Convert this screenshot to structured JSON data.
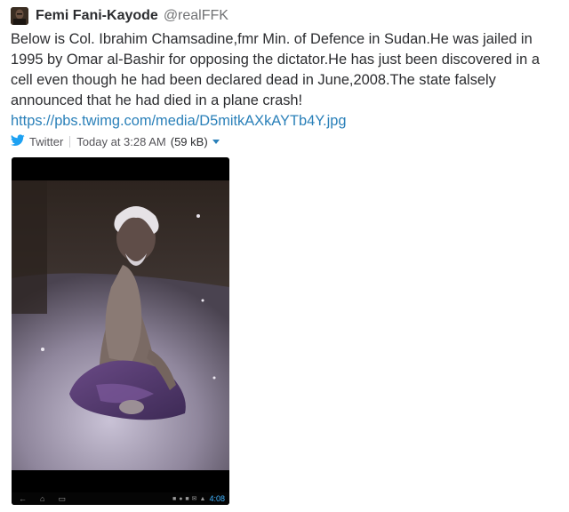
{
  "author": {
    "name": "Femi Fani-Kayode",
    "handle": "@realFFK"
  },
  "tweet": {
    "text": "Below is Col. Ibrahim Chamsadine,fmr Min. of Defence in Sudan.He was jailed in 1995 by Omar al-Bashir for opposing the dictator.He has just been discovered in a cell even though he had been declared dead in June,2008.The state falsely announced that he had died in a plane crash!",
    "link": "https://pbs.twimg.com/media/D5mitkAXkAYTb4Y.jpg"
  },
  "meta": {
    "source": "Twitter",
    "time": "Today at 3:28 AM",
    "size": "(59 kB)",
    "source_icon": "twitter-bird-icon",
    "accent_color": "#2a80b9",
    "twitter_blue": "#1da1f2"
  },
  "phone": {
    "clock": "4:08",
    "nav_icons": [
      "back-icon",
      "home-icon",
      "recent-apps-icon"
    ]
  }
}
